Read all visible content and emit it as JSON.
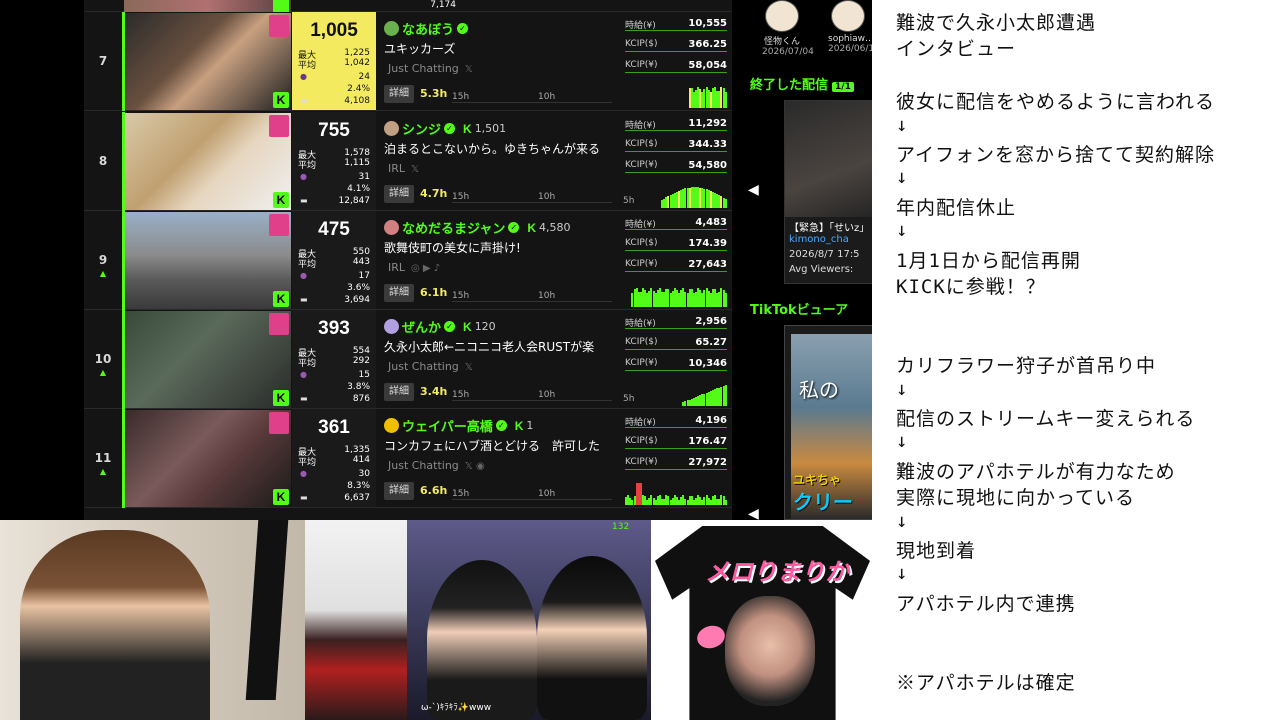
{
  "ranking": {
    "top_peek": {
      "avg": "7,174"
    },
    "rows": [
      {
        "rank": "7",
        "trend": "",
        "k": "K",
        "viewers": "1,005",
        "max_label": "最大",
        "max": "1,225",
        "avg_label": "平均",
        "avg": "1,042",
        "count": "24",
        "pct": "2.4%",
        "total": "4,108",
        "channel": "なあぼう",
        "followers": "",
        "title": "ユキッカーズ",
        "category": "Just Chatting",
        "socials": "𝕏",
        "detail": "詳細",
        "duration": "5.3h",
        "t1": "15h",
        "t2": "10h",
        "hourly_label": "時給(¥)",
        "hourly": "10,555",
        "kcip_usd_label": "KCIP($)",
        "kcip_usd": "366.25",
        "kcip_jpy_label": "KCIP(¥)",
        "kcip_jpy": "58,054",
        "chart_label": ""
      },
      {
        "rank": "8",
        "trend": "",
        "k": "K",
        "viewers": "755",
        "max_label": "最大",
        "max": "1,578",
        "avg_label": "平均",
        "avg": "1,115",
        "count": "31",
        "pct": "4.1%",
        "total": "12,847",
        "channel": "シンジ",
        "followers": "1,501",
        "title": "泊まるとこないから。ゆきちゃんが来る",
        "category": "IRL",
        "socials": "𝕏",
        "detail": "詳細",
        "duration": "4.7h",
        "t1": "15h",
        "t2": "10h",
        "hourly_label": "時給(¥)",
        "hourly": "11,292",
        "kcip_usd_label": "KCIP($)",
        "kcip_usd": "344.33",
        "kcip_jpy_label": "KCIP(¥)",
        "kcip_jpy": "54,580",
        "chart_label": "5h"
      },
      {
        "rank": "9",
        "trend": "▲",
        "k": "K",
        "viewers": "475",
        "max_label": "最大",
        "max": "550",
        "avg_label": "平均",
        "avg": "443",
        "count": "17",
        "pct": "3.6%",
        "total": "3,694",
        "channel": "なめだるまジャン",
        "followers": "4,580",
        "title": "歌舞伎町の美女に声掛け!",
        "category": "IRL",
        "socials": "◎ ▶ ♪",
        "detail": "詳細",
        "duration": "6.1h",
        "t1": "15h",
        "t2": "10h",
        "hourly_label": "時給(¥)",
        "hourly": "4,483",
        "kcip_usd_label": "KCIP($)",
        "kcip_usd": "174.39",
        "kcip_jpy_label": "KCIP(¥)",
        "kcip_jpy": "27,643",
        "chart_label": ""
      },
      {
        "rank": "10",
        "trend": "▲",
        "k": "K",
        "viewers": "393",
        "max_label": "最大",
        "max": "554",
        "avg_label": "平均",
        "avg": "292",
        "count": "15",
        "pct": "3.8%",
        "total": "876",
        "channel": "ぜんか",
        "followers": "120",
        "title": "久永小太郎←ニコニコ老人会RUSTが楽",
        "category": "Just Chatting",
        "socials": "𝕏",
        "detail": "詳細",
        "duration": "3.4h",
        "t1": "15h",
        "t2": "10h",
        "hourly_label": "時給(¥)",
        "hourly": "2,956",
        "kcip_usd_label": "KCIP($)",
        "kcip_usd": "65.27",
        "kcip_jpy_label": "KCIP(¥)",
        "kcip_jpy": "10,346",
        "chart_label": "5h"
      },
      {
        "rank": "11",
        "trend": "▲",
        "k": "K",
        "viewers": "361",
        "max_label": "最大",
        "max": "1,335",
        "avg_label": "平均",
        "avg": "414",
        "count": "30",
        "pct": "8.3%",
        "total": "6,637",
        "channel": "ウェイパー高橋",
        "followers": "1",
        "title": "コンカフェにハブ酒とどける　許可した",
        "category": "Just Chatting",
        "socials": "𝕏 ◉",
        "detail": "詳細",
        "duration": "6.6h",
        "t1": "15h",
        "t2": "10h",
        "hourly_label": "時給(¥)",
        "hourly": "4,196",
        "kcip_usd_label": "KCIP($)",
        "kcip_usd": "176.47",
        "kcip_jpy_label": "KCIP(¥)",
        "kcip_jpy": "27,972",
        "chart_label": ""
      }
    ]
  },
  "middle": {
    "mini_users": [
      {
        "name": "怪物くん",
        "date": "2026/07/04"
      },
      {
        "name": "sophiaw…",
        "date": "2026/06/1"
      }
    ],
    "ended_title": "終了した配信",
    "ended_badge": "1/1",
    "ended_card": {
      "title": "【緊急】「せいz」",
      "user": "kimono_cha",
      "date": "2026/8/7 17:5",
      "avg": "Avg Viewers:"
    },
    "tiktok_title": "TikTokビューア",
    "tiktok_card": {
      "text1": "私の",
      "text2": "ユキちゃ",
      "text3": "クリー"
    },
    "nav_prev": "◀"
  },
  "notes": {
    "lines": [
      "難波で久永小太郎遭遇",
      "インタビュー",
      "",
      "彼女に配信をやめるように言われる",
      "↓",
      "アイフォンを窓から捨てて契約解除",
      "↓",
      "年内配信休止",
      "↓",
      "1月1日から配信再開",
      "KICKに参戦！？",
      "",
      "",
      "カリフラワー狩子が首吊り中",
      "↓",
      "配信のストリームキー変えられる",
      "↓",
      "難波のアパホテルが有力なため",
      "実際に現地に向かっている",
      "↓",
      "現地到着",
      "↓",
      "アパホテル内で連携",
      "",
      "",
      "※アパホテルは確定"
    ]
  },
  "bottom": {
    "cam3_caption": "ω-`)ｷﾗｷﾗ✨www",
    "cam3_hud": "132",
    "shirt_logo": "メロりまりか"
  },
  "colors": {
    "accent": "#53fc18",
    "highlight": "#f3ea5f",
    "link": "#4aa8ff"
  }
}
